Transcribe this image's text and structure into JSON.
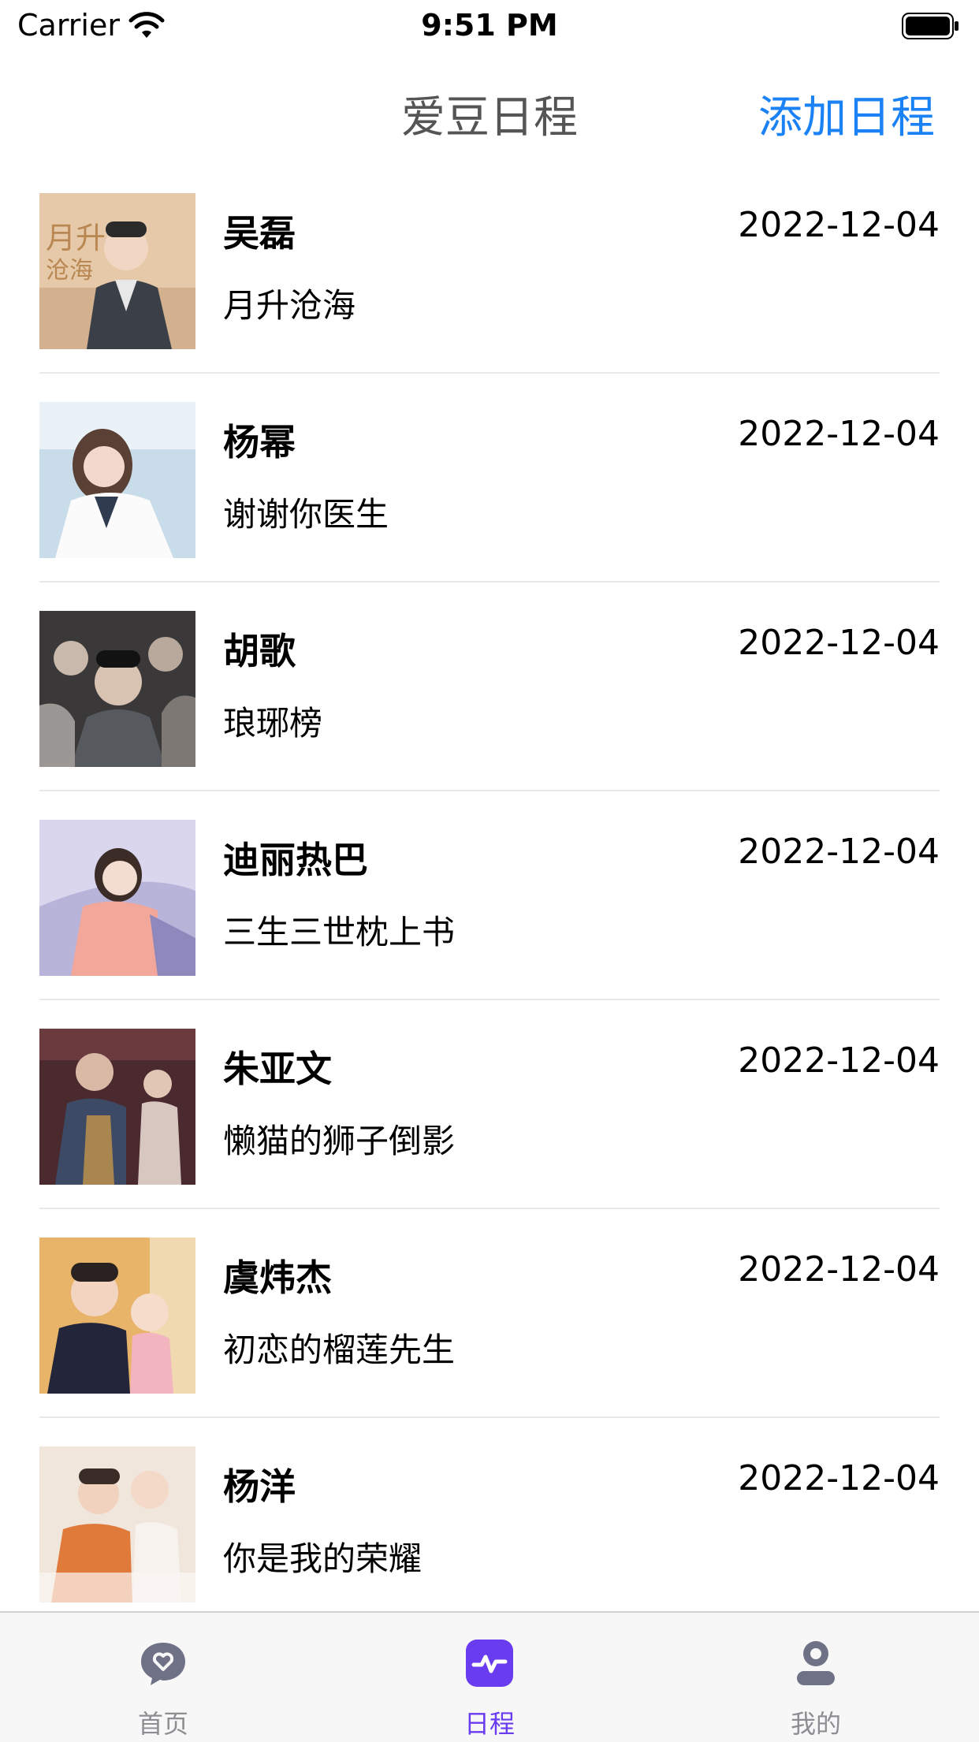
{
  "status_bar": {
    "carrier": "Carrier",
    "time": "9:51 PM"
  },
  "nav": {
    "title": "爱豆日程",
    "add_label": "添加日程",
    "accent_color": "#1a82f5"
  },
  "items": [
    {
      "name": "吴磊",
      "date": "2022-12-04",
      "show": "月升沧海"
    },
    {
      "name": "杨幂",
      "date": "2022-12-04",
      "show": "谢谢你医生"
    },
    {
      "name": "胡歌",
      "date": "2022-12-04",
      "show": "琅琊榜"
    },
    {
      "name": "迪丽热巴",
      "date": "2022-12-04",
      "show": "三生三世枕上书"
    },
    {
      "name": "朱亚文",
      "date": "2022-12-04",
      "show": "懒猫的狮子倒影"
    },
    {
      "name": "虞炜杰",
      "date": "2022-12-04",
      "show": "初恋的榴莲先生"
    },
    {
      "name": "杨洋",
      "date": "2022-12-04",
      "show": "你是我的荣耀"
    }
  ],
  "tabs": [
    {
      "label": "首页",
      "icon": "heart-chat-icon",
      "active": false
    },
    {
      "label": "日程",
      "icon": "pulse-icon",
      "active": true
    },
    {
      "label": "我的",
      "icon": "person-icon",
      "active": false
    }
  ],
  "colors": {
    "tab_active": "#6a3cf0",
    "tab_inactive": "#8d8d92"
  }
}
